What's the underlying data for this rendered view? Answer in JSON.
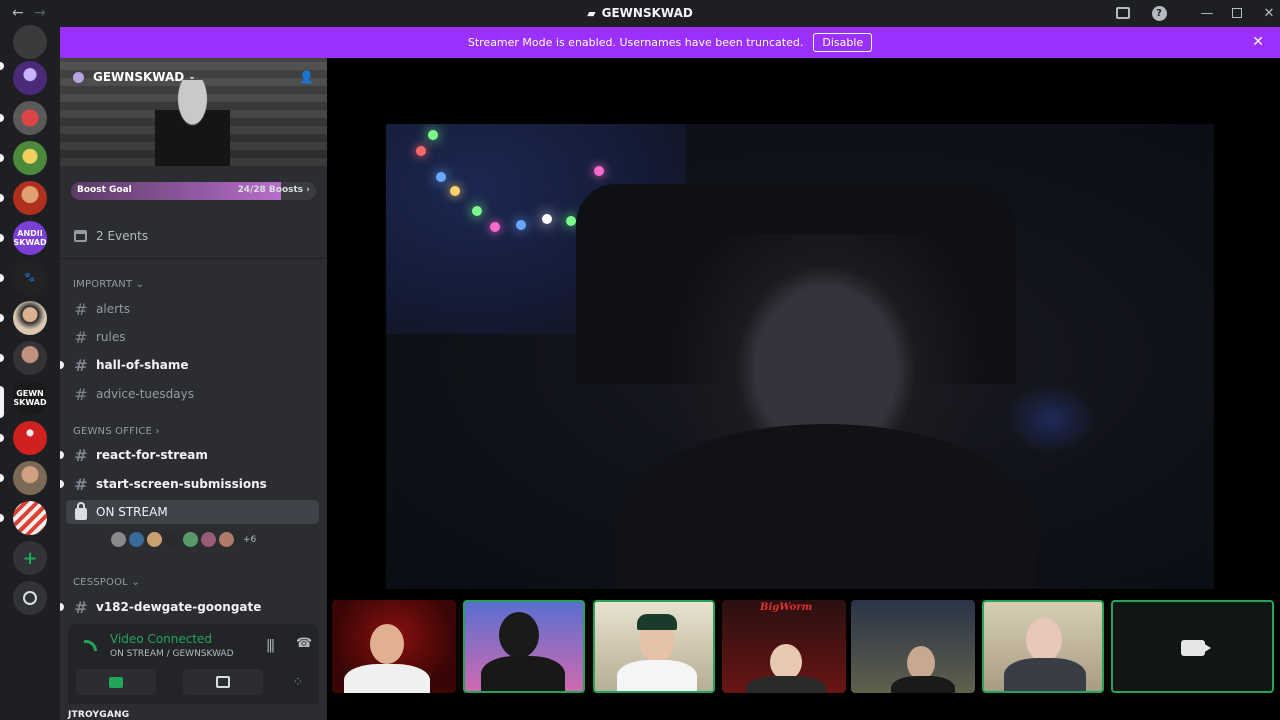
{
  "window": {
    "title": "GEWNSKWAD",
    "back_icon": "←",
    "forward_icon": "→",
    "minimize_icon": "—",
    "close_icon": "✕"
  },
  "banner": {
    "message": "Streamer Mode is enabled. Usernames have been truncated.",
    "button": "Disable",
    "close_icon": "✕",
    "color": "#9b30ff"
  },
  "rail": {
    "servers": [
      {
        "name": "server-1",
        "color": "#3b3b3b"
      },
      {
        "name": "server-2",
        "color": "#4b2a7a"
      },
      {
        "name": "server-3",
        "color": "#b23a3a"
      },
      {
        "name": "server-4",
        "color": "#5a8a3a"
      },
      {
        "name": "server-5",
        "color": "#c8642a"
      },
      {
        "name": "server-andii",
        "label": "ANDII SKWAD",
        "color": "#7a3fd6"
      },
      {
        "name": "server-7",
        "color": "#222222"
      },
      {
        "name": "server-8",
        "color": "#d9c7b0"
      },
      {
        "name": "server-9",
        "color": "#444444"
      },
      {
        "name": "server-gewnskwad",
        "label": "GEWN SKWAD",
        "color": "#1a1a1a"
      },
      {
        "name": "server-11",
        "color": "#c42020"
      },
      {
        "name": "server-12",
        "color": "#7a6a55"
      },
      {
        "name": "server-13",
        "color": "#e8e8e8"
      }
    ],
    "add_icon": "+"
  },
  "server": {
    "name": "GEWNSKWAD",
    "chevron": "⌄",
    "invite_icon": "👤",
    "boost": {
      "label": "Boost Goal",
      "progress_text": "24/28 Boosts",
      "progress": 0.857
    }
  },
  "events": {
    "label": "2 Events"
  },
  "categories": [
    {
      "label": "IMPORTANT",
      "chev": "⌄"
    },
    {
      "label": "GEWNS OFFICE",
      "chev": "›"
    },
    {
      "label": "CESSPOOL",
      "chev": "⌄"
    }
  ],
  "channels": [
    {
      "label": "alerts",
      "unread": false
    },
    {
      "label": "rules",
      "unread": false
    },
    {
      "label": "hall-of-shame",
      "unread": true
    },
    {
      "label": "advice-tuesdays",
      "unread": false
    },
    {
      "label": "react-for-stream",
      "unread": true
    },
    {
      "label": "start-screen-submissions",
      "unread": true
    },
    {
      "label": "ON STREAM",
      "voice": true
    },
    {
      "label": "v182-dewgate-goongate",
      "unread": true
    }
  ],
  "hash_icon": "#",
  "voice_users": {
    "colors": [
      "#8a8a8a",
      "#3a6a9a",
      "#c9a070",
      "#2a2a2a",
      "#5a9a6a",
      "#9a5a7a",
      "#b07a6a"
    ],
    "more": "+6"
  },
  "voice_panel": {
    "status": "Video Connected",
    "channel": "ON STREAM / GEWNSKWAD",
    "wave_icon": "|||",
    "hangup_icon": "☎",
    "activity_icon": "⁘"
  },
  "user": {
    "name": "JTROYGANG"
  },
  "status_colors": {
    "connected": "#23a559",
    "accent": "#5865f2"
  }
}
